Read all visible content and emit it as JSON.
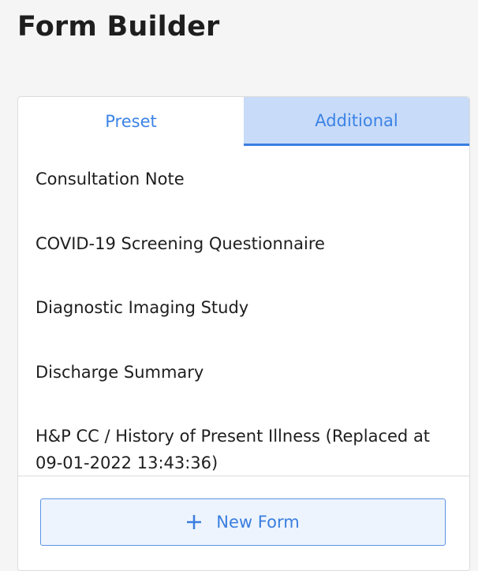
{
  "page": {
    "title": "Form Builder"
  },
  "tabs": [
    {
      "label": "Preset",
      "active": false
    },
    {
      "label": "Additional",
      "active": true
    }
  ],
  "forms": [
    {
      "label": "Consultation Note"
    },
    {
      "label": "COVID-19 Screening Questionnaire"
    },
    {
      "label": "Diagnostic Imaging Study"
    },
    {
      "label": "Discharge Summary"
    },
    {
      "label": "H&P CC / History of Present Illness (Replaced at 09-01-2022 13:43:36)"
    }
  ],
  "actions": {
    "new_form_label": "New Form",
    "new_form_icon": "plus-icon"
  },
  "colors": {
    "accent": "#3a7ee0",
    "active_tab_bg": "#c8dbf8",
    "button_bg": "#eef4fd",
    "background": "#f5f5f5"
  }
}
